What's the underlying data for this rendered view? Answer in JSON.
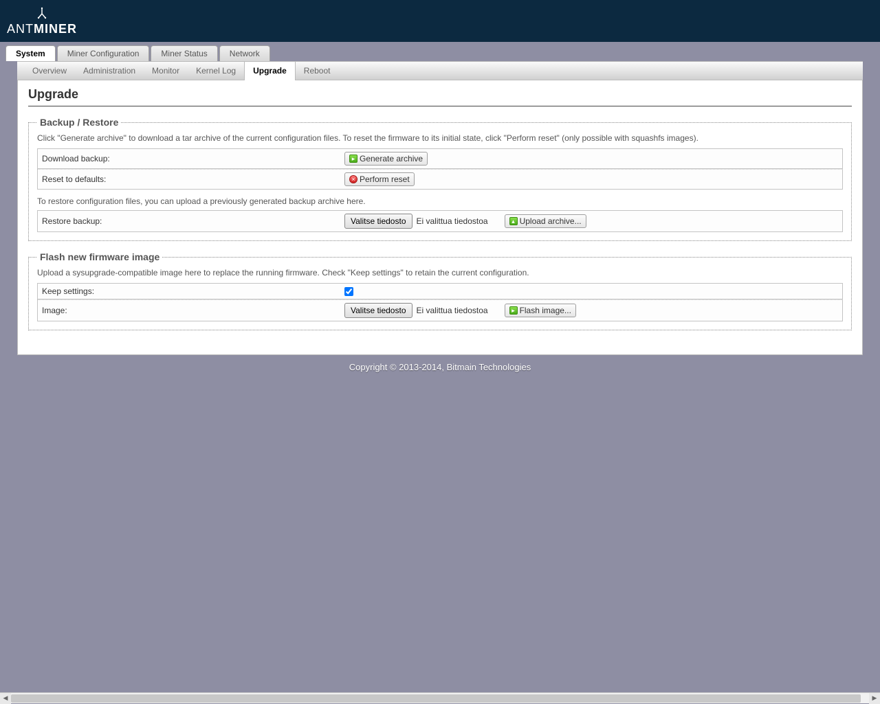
{
  "brand": {
    "name_thin": "ANT",
    "name_bold": "MINER"
  },
  "main_tabs": [
    {
      "label": "System",
      "active": true
    },
    {
      "label": "Miner Configuration",
      "active": false
    },
    {
      "label": "Miner Status",
      "active": false
    },
    {
      "label": "Network",
      "active": false
    }
  ],
  "sub_tabs": [
    {
      "label": "Overview",
      "active": false
    },
    {
      "label": "Administration",
      "active": false
    },
    {
      "label": "Monitor",
      "active": false
    },
    {
      "label": "Kernel Log",
      "active": false
    },
    {
      "label": "Upgrade",
      "active": true
    },
    {
      "label": "Reboot",
      "active": false
    }
  ],
  "page_title": "Upgrade",
  "backup": {
    "legend": "Backup / Restore",
    "desc": "Click \"Generate archive\" to download a tar archive of the current configuration files. To reset the firmware to its initial state, click \"Perform reset\" (only possible with squashfs images).",
    "download_label": "Download backup:",
    "generate_btn": "Generate archive",
    "reset_label": "Reset to defaults:",
    "reset_btn": "Perform reset",
    "restore_note": "To restore configuration files, you can upload a previously generated backup archive here.",
    "restore_label": "Restore backup:",
    "file_btn": "Valitse tiedosto",
    "file_status": "Ei valittua tiedostoa",
    "upload_btn": "Upload archive..."
  },
  "flash": {
    "legend": "Flash new firmware image",
    "desc": "Upload a sysupgrade-compatible image here to replace the running firmware. Check \"Keep settings\" to retain the current configuration.",
    "keep_label": "Keep settings:",
    "keep_checked": true,
    "image_label": "Image:",
    "file_btn": "Valitse tiedosto",
    "file_status": "Ei valittua tiedostoa",
    "flash_btn": "Flash image..."
  },
  "footer": "Copyright © 2013-2014, Bitmain Technologies"
}
